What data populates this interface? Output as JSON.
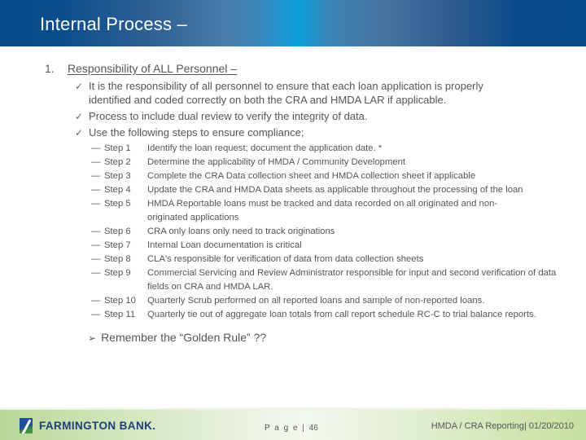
{
  "header": {
    "title": "Internal Process –"
  },
  "section": {
    "number": "1.",
    "title": "Responsibility of ALL Personnel –"
  },
  "checks": [
    {
      "icon": "checkmark-icon",
      "text": "It is the responsibility of all personnel to ensure that each loan application is properly identified and coded correctly on both the CRA and HMDA LAR if applicable."
    },
    {
      "icon": "checkmark-icon",
      "text": "Process to include dual review to verify the integrity of data."
    },
    {
      "icon": "checkmark-icon",
      "text": "Use the following steps to ensure compliance;"
    }
  ],
  "steps": [
    {
      "dash": "—",
      "label": "Step 1",
      "desc": "Identify the loan request; document the application date.  *"
    },
    {
      "dash": "—",
      "label": "Step 2",
      "desc": "Determine the applicability of HMDA / Community Development"
    },
    {
      "dash": "—",
      "label": "Step 3",
      "desc": "Complete the CRA Data collection sheet and HMDA collection sheet if applicable"
    },
    {
      "dash": "—",
      "label": "Step 4",
      "desc": "Update the CRA and HMDA Data sheets as applicable throughout the processing of the loan"
    },
    {
      "dash": "—",
      "label": "Step 5",
      "desc": "HMDA Reportable loans must be tracked and data recorded on all originated and non-originated applications"
    },
    {
      "dash": "—",
      "label": "Step 6",
      "desc": "CRA only loans only need to track originations"
    },
    {
      "dash": "—",
      "label": "Step 7",
      "desc": "Internal Loan documentation is critical"
    },
    {
      "dash": "—",
      "label": "Step 8",
      "desc": "CLA's responsible for verification of data from data collection sheets"
    },
    {
      "dash": "—",
      "label": "Step 9",
      "desc": "Commercial Servicing and Review Administrator responsible for input and second verification of data fields on CRA and HMDA LAR."
    },
    {
      "dash": "—",
      "label": "Step 10",
      "desc": "Quarterly Scrub performed on all reported loans and sample of non-reported loans."
    },
    {
      "dash": "—",
      "label": "Step 11",
      "desc": "Quarterly tie out of aggregate loan totals from call report schedule RC-C to trial balance reports."
    }
  ],
  "reminder": {
    "arrow": "➢",
    "text": "Remember the “Golden Rule” ??"
  },
  "footer": {
    "logo_text": "FARMINGTON BANK.",
    "page_label": "P a g e | ",
    "page_number": "46",
    "right_text": "HMDA / CRA Reporting| 01/20/2010"
  }
}
